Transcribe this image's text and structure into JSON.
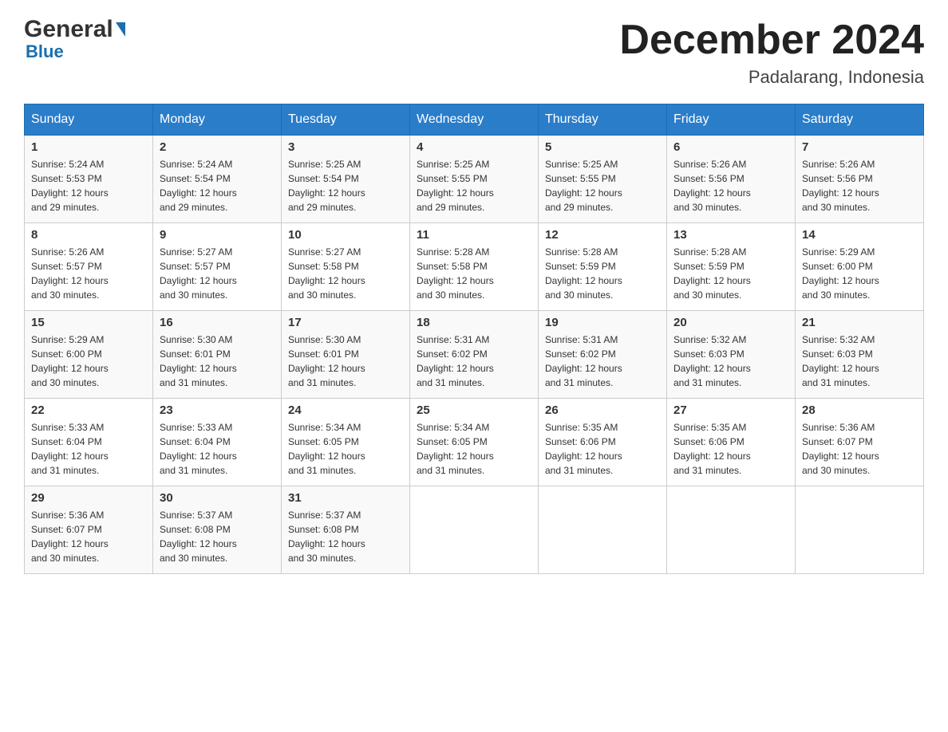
{
  "header": {
    "logo": {
      "general": "General",
      "blue": "Blue",
      "triangle_color": "#1a6faf"
    },
    "title": "December 2024",
    "location": "Padalarang, Indonesia"
  },
  "calendar": {
    "days_of_week": [
      "Sunday",
      "Monday",
      "Tuesday",
      "Wednesday",
      "Thursday",
      "Friday",
      "Saturday"
    ],
    "weeks": [
      [
        {
          "day": "1",
          "sunrise": "5:24 AM",
          "sunset": "5:53 PM",
          "daylight": "12 hours and 29 minutes."
        },
        {
          "day": "2",
          "sunrise": "5:24 AM",
          "sunset": "5:54 PM",
          "daylight": "12 hours and 29 minutes."
        },
        {
          "day": "3",
          "sunrise": "5:25 AM",
          "sunset": "5:54 PM",
          "daylight": "12 hours and 29 minutes."
        },
        {
          "day": "4",
          "sunrise": "5:25 AM",
          "sunset": "5:55 PM",
          "daylight": "12 hours and 29 minutes."
        },
        {
          "day": "5",
          "sunrise": "5:25 AM",
          "sunset": "5:55 PM",
          "daylight": "12 hours and 29 minutes."
        },
        {
          "day": "6",
          "sunrise": "5:26 AM",
          "sunset": "5:56 PM",
          "daylight": "12 hours and 30 minutes."
        },
        {
          "day": "7",
          "sunrise": "5:26 AM",
          "sunset": "5:56 PM",
          "daylight": "12 hours and 30 minutes."
        }
      ],
      [
        {
          "day": "8",
          "sunrise": "5:26 AM",
          "sunset": "5:57 PM",
          "daylight": "12 hours and 30 minutes."
        },
        {
          "day": "9",
          "sunrise": "5:27 AM",
          "sunset": "5:57 PM",
          "daylight": "12 hours and 30 minutes."
        },
        {
          "day": "10",
          "sunrise": "5:27 AM",
          "sunset": "5:58 PM",
          "daylight": "12 hours and 30 minutes."
        },
        {
          "day": "11",
          "sunrise": "5:28 AM",
          "sunset": "5:58 PM",
          "daylight": "12 hours and 30 minutes."
        },
        {
          "day": "12",
          "sunrise": "5:28 AM",
          "sunset": "5:59 PM",
          "daylight": "12 hours and 30 minutes."
        },
        {
          "day": "13",
          "sunrise": "5:28 AM",
          "sunset": "5:59 PM",
          "daylight": "12 hours and 30 minutes."
        },
        {
          "day": "14",
          "sunrise": "5:29 AM",
          "sunset": "6:00 PM",
          "daylight": "12 hours and 30 minutes."
        }
      ],
      [
        {
          "day": "15",
          "sunrise": "5:29 AM",
          "sunset": "6:00 PM",
          "daylight": "12 hours and 30 minutes."
        },
        {
          "day": "16",
          "sunrise": "5:30 AM",
          "sunset": "6:01 PM",
          "daylight": "12 hours and 31 minutes."
        },
        {
          "day": "17",
          "sunrise": "5:30 AM",
          "sunset": "6:01 PM",
          "daylight": "12 hours and 31 minutes."
        },
        {
          "day": "18",
          "sunrise": "5:31 AM",
          "sunset": "6:02 PM",
          "daylight": "12 hours and 31 minutes."
        },
        {
          "day": "19",
          "sunrise": "5:31 AM",
          "sunset": "6:02 PM",
          "daylight": "12 hours and 31 minutes."
        },
        {
          "day": "20",
          "sunrise": "5:32 AM",
          "sunset": "6:03 PM",
          "daylight": "12 hours and 31 minutes."
        },
        {
          "day": "21",
          "sunrise": "5:32 AM",
          "sunset": "6:03 PM",
          "daylight": "12 hours and 31 minutes."
        }
      ],
      [
        {
          "day": "22",
          "sunrise": "5:33 AM",
          "sunset": "6:04 PM",
          "daylight": "12 hours and 31 minutes."
        },
        {
          "day": "23",
          "sunrise": "5:33 AM",
          "sunset": "6:04 PM",
          "daylight": "12 hours and 31 minutes."
        },
        {
          "day": "24",
          "sunrise": "5:34 AM",
          "sunset": "6:05 PM",
          "daylight": "12 hours and 31 minutes."
        },
        {
          "day": "25",
          "sunrise": "5:34 AM",
          "sunset": "6:05 PM",
          "daylight": "12 hours and 31 minutes."
        },
        {
          "day": "26",
          "sunrise": "5:35 AM",
          "sunset": "6:06 PM",
          "daylight": "12 hours and 31 minutes."
        },
        {
          "day": "27",
          "sunrise": "5:35 AM",
          "sunset": "6:06 PM",
          "daylight": "12 hours and 31 minutes."
        },
        {
          "day": "28",
          "sunrise": "5:36 AM",
          "sunset": "6:07 PM",
          "daylight": "12 hours and 30 minutes."
        }
      ],
      [
        {
          "day": "29",
          "sunrise": "5:36 AM",
          "sunset": "6:07 PM",
          "daylight": "12 hours and 30 minutes."
        },
        {
          "day": "30",
          "sunrise": "5:37 AM",
          "sunset": "6:08 PM",
          "daylight": "12 hours and 30 minutes."
        },
        {
          "day": "31",
          "sunrise": "5:37 AM",
          "sunset": "6:08 PM",
          "daylight": "12 hours and 30 minutes."
        },
        null,
        null,
        null,
        null
      ]
    ],
    "labels": {
      "sunrise_prefix": "Sunrise: ",
      "sunset_prefix": "Sunset: ",
      "daylight_prefix": "Daylight: "
    }
  }
}
